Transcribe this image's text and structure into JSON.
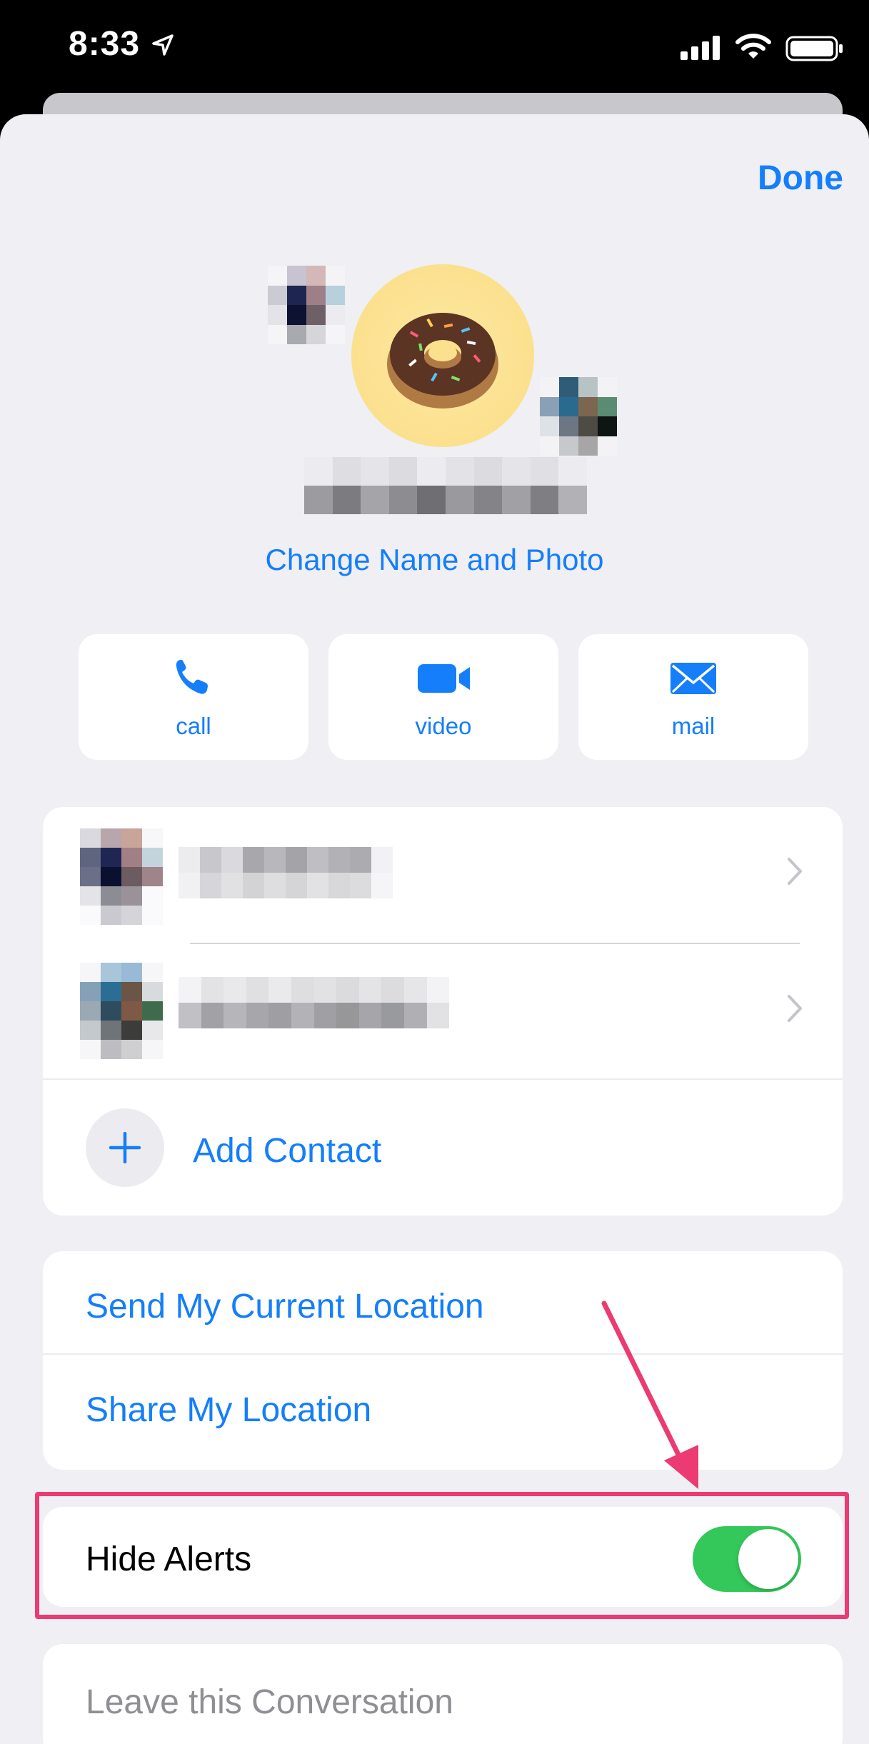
{
  "status_bar": {
    "time": "8:33",
    "icons": [
      "location-arrow-icon",
      "cellular-signal-icon",
      "wifi-icon",
      "battery-icon"
    ]
  },
  "header": {
    "done_label": "Done"
  },
  "group": {
    "avatar_emoji": "🍩",
    "change_link": "Change Name and Photo"
  },
  "actions": [
    {
      "label": "call",
      "icon": "phone-icon"
    },
    {
      "label": "video",
      "icon": "video-camera-icon"
    },
    {
      "label": "mail",
      "icon": "envelope-icon"
    }
  ],
  "members": {
    "add_contact_label": "Add Contact"
  },
  "location": {
    "send_current_label": "Send My Current Location",
    "share_label": "Share My Location"
  },
  "alerts": {
    "hide_alerts_label": "Hide Alerts",
    "hide_alerts_on": true
  },
  "leave": {
    "label": "Leave this Conversation"
  },
  "colors": {
    "accent": "#147efb",
    "toggle_on": "#34c759",
    "highlight": "#ec3a72",
    "sheet_bg": "#efeff4"
  }
}
